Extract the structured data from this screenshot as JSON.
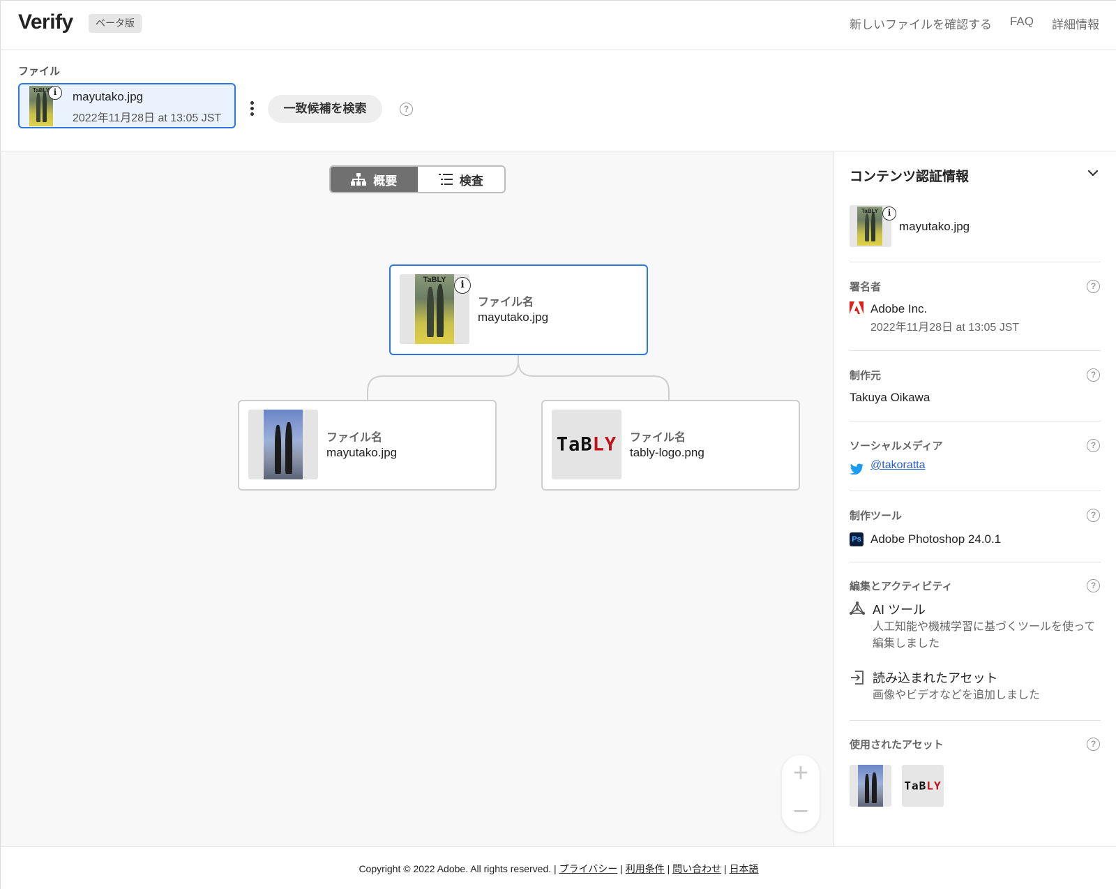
{
  "header": {
    "brand": "Verify",
    "beta_label": "ベータ版",
    "links": [
      "新しいファイルを確認する",
      "FAQ",
      "詳細情報"
    ]
  },
  "file_bar": {
    "section_label": "ファイル",
    "file": {
      "name": "mayutako.jpg",
      "date": "2022年11月28日 at 13:05 JST",
      "info_glyph": "i"
    },
    "find_matches_label": "一致候補を検索",
    "help_glyph": "?"
  },
  "view_toggle": {
    "overview_label": "概要",
    "inspect_label": "検査",
    "active": "overview"
  },
  "tree": {
    "root": {
      "label": "ファイル名",
      "name": "mayutako.jpg",
      "thumb_text": "TaBLY"
    },
    "children": [
      {
        "label": "ファイル名",
        "name": "mayutako.jpg"
      },
      {
        "label": "ファイル名",
        "name": "tably-logo.png",
        "logo_text": "TaBLY"
      }
    ]
  },
  "zoom": {
    "in": "+",
    "out": "−"
  },
  "panel": {
    "title": "コンテンツ認証情報",
    "file_name": "mayutako.jpg",
    "signer": {
      "label": "署名者",
      "name": "Adobe Inc.",
      "date": "2022年11月28日 at 13:05 JST"
    },
    "producer": {
      "label": "制作元",
      "name": "Takuya Oikawa"
    },
    "social": {
      "label": "ソーシャルメディア",
      "handle": "@takoratta"
    },
    "tool": {
      "label": "制作ツール",
      "name": "Adobe Photoshop 24.0.1",
      "badge": "Ps"
    },
    "edits": {
      "label": "編集とアクティビティ",
      "items": [
        {
          "title": "AI ツール",
          "desc": "人工知能や機械学習に基づくツールを使って編集しました"
        },
        {
          "title": "読み込まれたアセット",
          "desc": "画像やビデオなどを追加しました"
        }
      ]
    },
    "assets": {
      "label": "使用されたアセット",
      "logo_text": "TaBLY"
    }
  },
  "footer": {
    "copyright": "Copyright © 2022 Adobe. All rights reserved.",
    "separator": "|",
    "links": [
      "プライバシー",
      "利用条件",
      "問い合わせ",
      "日本語"
    ]
  },
  "colors": {
    "accent": "#2e76e0",
    "toggle_active": "#707070",
    "adobe_red": "#e0201b",
    "twitter_blue": "#1d9bf0",
    "ps_badge": "#0b1d3f",
    "tably_red": "#c0131e"
  },
  "icons": {
    "signer": "adobe-logo-icon",
    "social": "twitter-icon",
    "tool": "photoshop-icon",
    "edit_ai": "ai-tool-icon",
    "edit_import": "import-icon",
    "overview": "tree-icon",
    "inspect": "list-icon",
    "collapse": "chevron-down-icon"
  }
}
